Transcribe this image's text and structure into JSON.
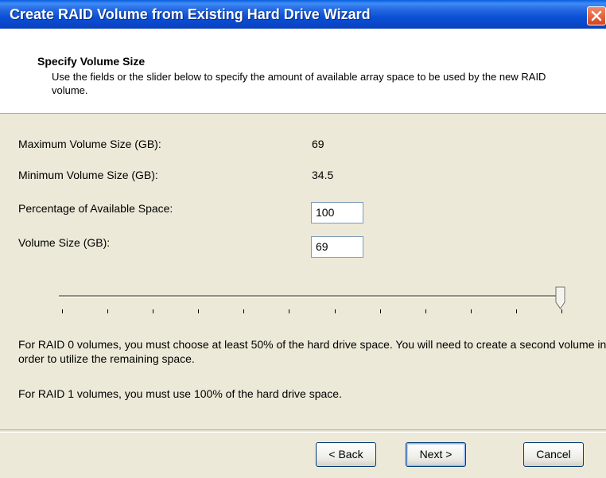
{
  "window": {
    "title": "Create RAID Volume from Existing Hard Drive Wizard"
  },
  "header": {
    "title": "Specify Volume Size",
    "description": "Use the fields or the slider below to specify the amount of available array space to be used by the new RAID volume."
  },
  "fields": {
    "max_label": "Maximum Volume Size (GB):",
    "max_value": "69",
    "min_label": "Minimum Volume Size (GB):",
    "min_value": "34.5",
    "percent_label": "Percentage of Available Space:",
    "percent_value": "100",
    "size_label": "Volume Size (GB):",
    "size_value": "69"
  },
  "slider": {
    "value_percent": 100,
    "tick_count": 12
  },
  "notes": {
    "raid0": "For RAID 0 volumes, you must choose at least 50% of the hard drive space. You will need to create a second volume in order to utilize the remaining space.",
    "raid1": "For RAID 1 volumes, you must use 100% of the hard drive space."
  },
  "buttons": {
    "back": "< Back",
    "next": "Next >",
    "cancel": "Cancel"
  },
  "colors": {
    "titlebar": "#0A47C9",
    "dialog_bg": "#ECE9D8",
    "close": "#D5451E"
  },
  "icons": {
    "close": "close-icon"
  }
}
